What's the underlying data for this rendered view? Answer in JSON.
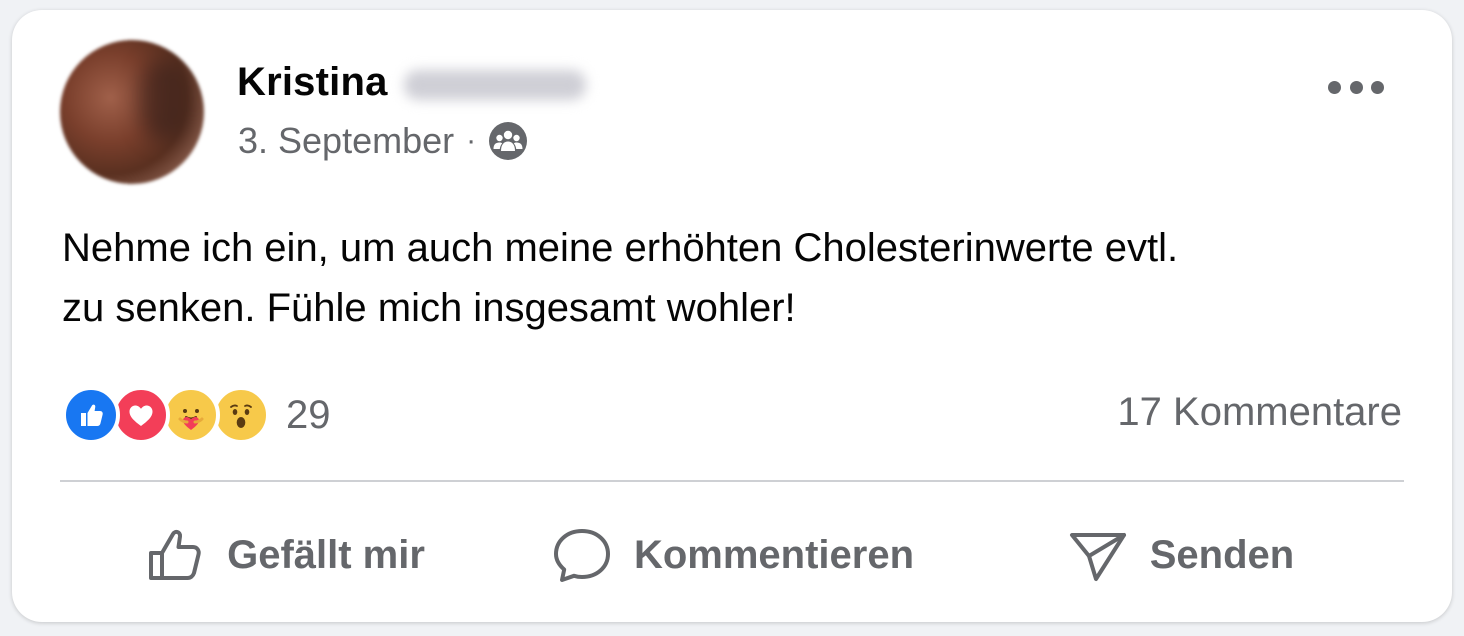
{
  "post": {
    "author_name": "Kristina",
    "date": "3. September",
    "separator": "·",
    "audience_icon": "friends-group-icon",
    "text_line1": "Nehme ich ein, um auch meine erhöhten Cholesterinwerte evtl.",
    "text_line2": "zu senken. Fühle mich insgesamt wohler!"
  },
  "reactions": {
    "types": [
      "like",
      "love",
      "care",
      "wow"
    ],
    "count": "29"
  },
  "comments": {
    "label": "17 Kommentare"
  },
  "actions": {
    "like_label": "Gefällt mir",
    "comment_label": "Kommentieren",
    "share_label": "Senden"
  },
  "colors": {
    "like_blue": "#1877f2",
    "love_red": "#f33e58",
    "emoji_yellow": "#f7c94a",
    "secondary_text": "#65676b",
    "divider": "#ced0d4"
  }
}
